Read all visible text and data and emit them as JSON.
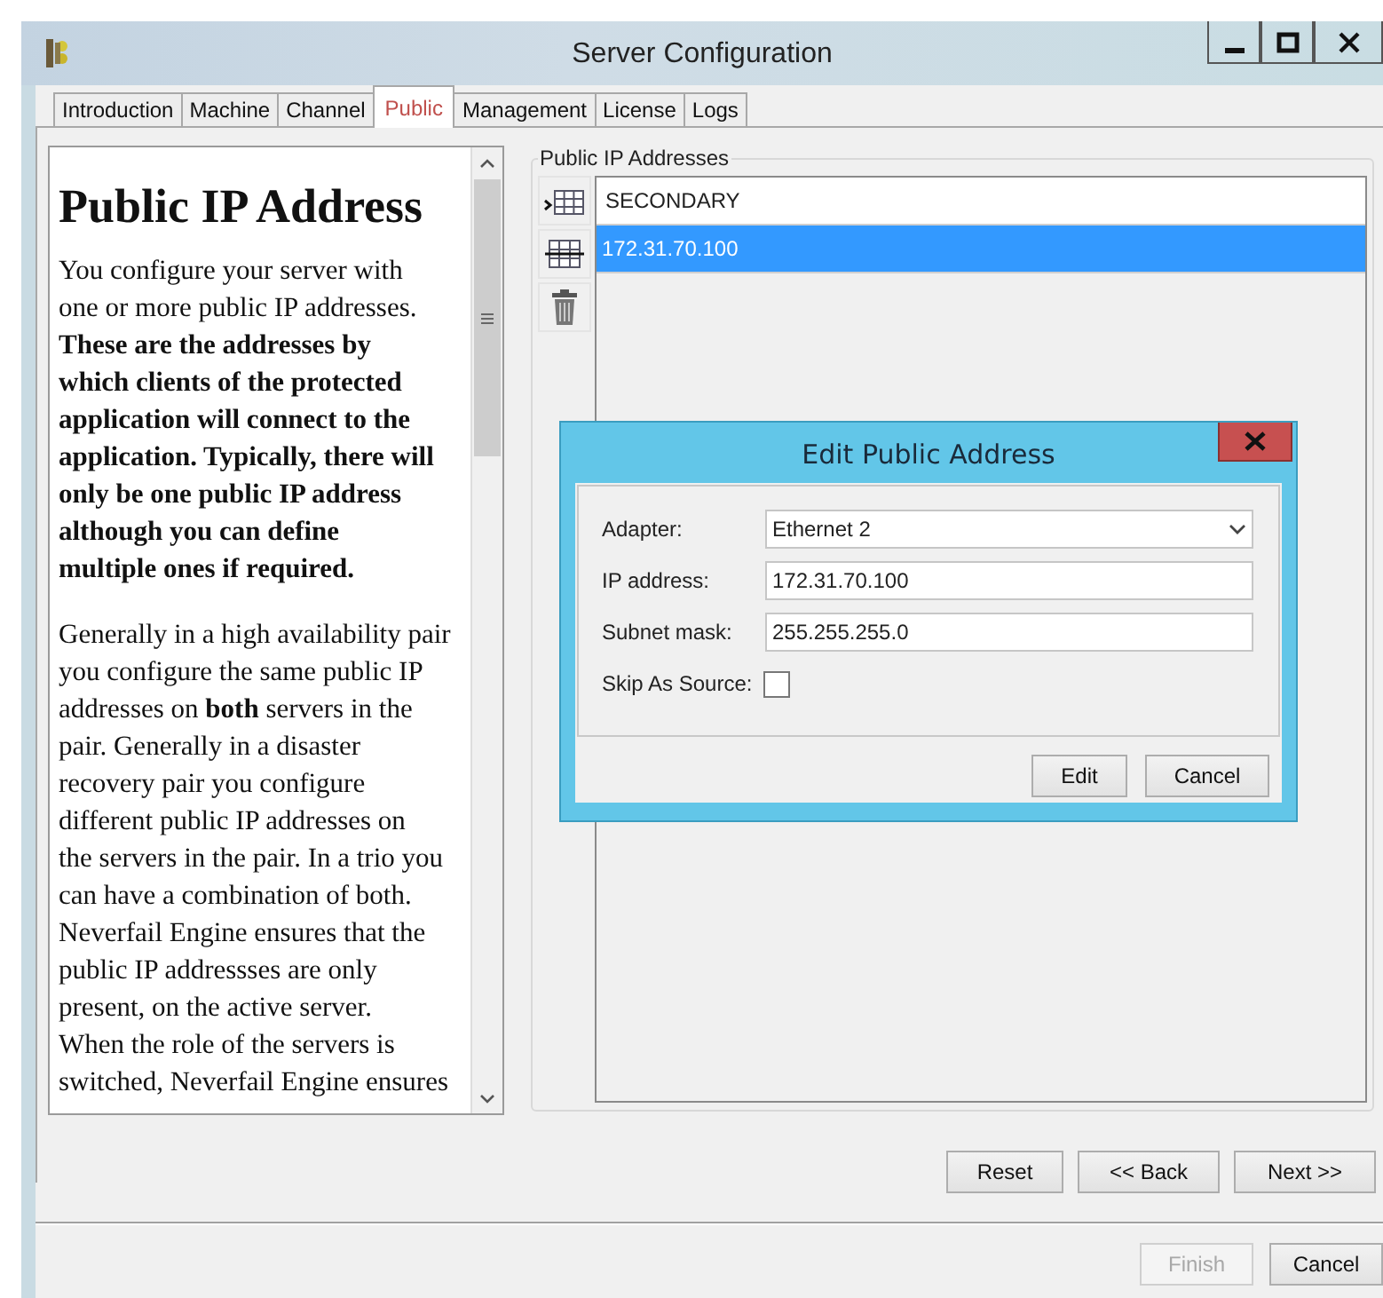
{
  "window": {
    "title": "Server Configuration"
  },
  "tabs": [
    {
      "label": "Introduction",
      "selected": false
    },
    {
      "label": "Machine",
      "selected": false
    },
    {
      "label": "Channel",
      "selected": false
    },
    {
      "label": "Public",
      "selected": true
    },
    {
      "label": "Management",
      "selected": false
    },
    {
      "label": "License",
      "selected": false
    },
    {
      "label": "Logs",
      "selected": false
    }
  ],
  "help": {
    "heading": "Public IP Address",
    "paragraphs": [
      "You configure your server with\none or more public IP addresses.\n**These are the addresses by**\n**which clients of the protected**\n**application will connect to the**\n**application. Typically, there will**\n**only be one public IP address**\n**although you can define**\n**multiple ones if required.**",
      "Generally in a high availability pair\nyou configure the same public IP\naddresses on **both** servers in the\npair. Generally in a disaster\nrecovery pair you configure\ndifferent public IP addresses on\nthe servers in the pair. In a trio you\ncan have a combination of both.\nNeverfail Engine ensures that the\npublic IP addressses are only\npresent, on the active server.\nWhen the role of the servers is\nswitched, Neverfail Engine ensures"
    ]
  },
  "addresses": {
    "title": "Public IP Addresses",
    "header": "SECONDARY",
    "rows": [
      {
        "value": "172.31.70.100",
        "selected": true
      }
    ]
  },
  "dialog": {
    "title": "Edit Public Address",
    "fields": [
      {
        "kind": "select",
        "label": "Adapter:",
        "value": "Ethernet 2"
      },
      {
        "kind": "text",
        "label": "IP address:",
        "value": "172.31.70.100"
      },
      {
        "kind": "text",
        "label": "Subnet mask:",
        "value": "255.255.255.0"
      },
      {
        "kind": "checkbox",
        "label": "Skip As Source:",
        "checked": false
      }
    ],
    "buttons": [
      {
        "label": "Edit"
      },
      {
        "label": "Cancel"
      }
    ]
  },
  "nav_buttons": [
    {
      "label": "Reset"
    },
    {
      "label": "<< Back"
    },
    {
      "label": "Next >>"
    }
  ],
  "footer_buttons": [
    {
      "label": "Finish",
      "disabled": true
    },
    {
      "label": "Cancel",
      "disabled": false
    }
  ]
}
